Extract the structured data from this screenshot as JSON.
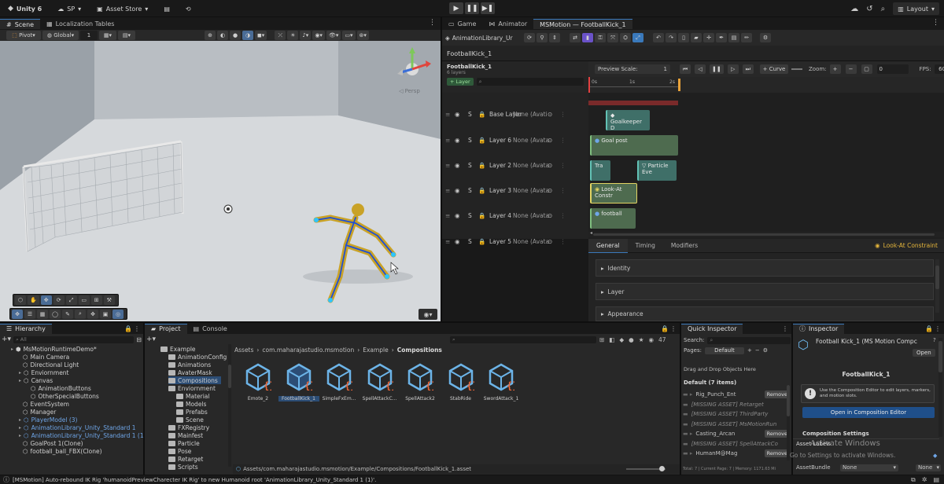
{
  "topbar": {
    "app": "Unity 6",
    "account": "SP",
    "asset_store": "Asset Store",
    "layout": "Layout"
  },
  "tabs_left": [
    "Scene",
    "Localization Tables"
  ],
  "tabs_right": [
    "Game",
    "Animator",
    "MSMotion — FootballKick_1"
  ],
  "scene_toolbar": {
    "pivot": "Pivot",
    "global": "Global",
    "grid_value": "1",
    "persp": "◁ Persp"
  },
  "msmotion": {
    "library": "AnimationLibrary_Ur",
    "title": "FootballKick_1",
    "comp_name": "FootballKick_1",
    "layer_count": "6 layers",
    "add_layer": "+ Layer",
    "preview_scale_label": "Preview Scale:",
    "preview_scale": "1",
    "curve": "+ Curve",
    "zoom": "Zoom:",
    "frame": "0",
    "fps_label": "FPS:",
    "fps": "60",
    "ruler": [
      "0s",
      "1s",
      "2s"
    ],
    "layers": [
      {
        "name": "Base Layer",
        "mask": "None (Avati"
      },
      {
        "name": "Layer 6",
        "mask": "None (Avata"
      },
      {
        "name": "Layer 2",
        "mask": "None (Avata"
      },
      {
        "name": "Layer 3",
        "mask": "None (Avata"
      },
      {
        "name": "Layer 4",
        "mask": "None (Avata"
      },
      {
        "name": "Layer 5",
        "mask": "None (Avata"
      }
    ],
    "clips": [
      "Goalkeeper D",
      "Goal post",
      "Tra",
      "Particle Eve",
      "Look-At Constr",
      "football"
    ],
    "inspector_tabs": [
      "General",
      "Timing",
      "Modifiers"
    ],
    "selected_marker": "Look-At Constraint",
    "sections": [
      "Identity",
      "Layer",
      "Appearance"
    ]
  },
  "hierarchy": {
    "title": "Hierarchy",
    "search": "All",
    "items": [
      {
        "label": "MsMotionRuntimeDemo*",
        "indent": 1,
        "blue": false
      },
      {
        "label": "Main Camera",
        "indent": 2,
        "blue": false
      },
      {
        "label": "Directional Light",
        "indent": 2,
        "blue": false
      },
      {
        "label": "Enviornment",
        "indent": 2,
        "blue": false
      },
      {
        "label": "Canvas",
        "indent": 2,
        "blue": false
      },
      {
        "label": "AnimationButtons",
        "indent": 3,
        "blue": false
      },
      {
        "label": "OtherSpecialButtons",
        "indent": 3,
        "blue": false
      },
      {
        "label": "EventSystem",
        "indent": 2,
        "blue": false
      },
      {
        "label": "Manager",
        "indent": 2,
        "blue": false
      },
      {
        "label": "PlayerModel (3)",
        "indent": 2,
        "blue": true
      },
      {
        "label": "AnimationLibrary_Unity_Standard 1",
        "indent": 2,
        "blue": true
      },
      {
        "label": "AnimationLibrary_Unity_Standard 1 (1)",
        "indent": 2,
        "blue": true
      },
      {
        "label": "GoalPost 1(Clone)",
        "indent": 2,
        "blue": false
      },
      {
        "label": "football_ball_FBX(Clone)",
        "indent": 2,
        "blue": false
      }
    ]
  },
  "project": {
    "tabs": [
      "Project",
      "Console"
    ],
    "count": "47",
    "folders": [
      {
        "label": "Example",
        "indent": 1
      },
      {
        "label": "AnimationConfig",
        "indent": 2
      },
      {
        "label": "Animations",
        "indent": 2
      },
      {
        "label": "AvaterMask",
        "indent": 2
      },
      {
        "label": "Compositions",
        "indent": 2
      },
      {
        "label": "Enviornment",
        "indent": 2
      },
      {
        "label": "Material",
        "indent": 3
      },
      {
        "label": "Models",
        "indent": 3
      },
      {
        "label": "Prefabs",
        "indent": 3
      },
      {
        "label": "Scene",
        "indent": 3
      },
      {
        "label": "FXRegistry",
        "indent": 2
      },
      {
        "label": "Mainfest",
        "indent": 2
      },
      {
        "label": "Particle",
        "indent": 2
      },
      {
        "label": "Pose",
        "indent": 2
      },
      {
        "label": "Retarget",
        "indent": 2
      },
      {
        "label": "Scripts",
        "indent": 2
      }
    ],
    "breadcrumb": [
      "Assets",
      "com.maharajastudio.msmotion",
      "Example",
      "Compositions"
    ],
    "assets": [
      "Emote_2",
      "FootballKick_1",
      "SimpleFxEm...",
      "SpellAttackC...",
      "SpellAttack2",
      "StabRide",
      "SwordAttack_1"
    ],
    "path": "Assets/com.maharajastudio.msmotion/Example/Compositions/FootballKick_1.asset"
  },
  "quick_inspector": {
    "title": "Quick Inspector",
    "search_label": "Search:",
    "pages_label": "Pages:",
    "pages_value": "Default",
    "drop_hint": "Drag and Drop Objects Here",
    "group": "Default (7 items)",
    "items": [
      {
        "label": "Rig_Punch_Ent",
        "remove": true
      },
      {
        "label": "[MISSING ASSET] Retarget",
        "remove": false
      },
      {
        "label": "[MISSING ASSET] ThirdParty",
        "remove": false
      },
      {
        "label": "[MISSING ASSET] MsMotionRun",
        "remove": false
      },
      {
        "label": "Casting_Arcan",
        "remove": true
      },
      {
        "label": "[MISSING ASSET] SpellAttackCo",
        "remove": false
      },
      {
        "label": "HumanM@Mag",
        "remove": true
      }
    ],
    "remove_label": "Remove",
    "footer": "Total: 7 | Current Page: 7 | Memory: 1171.63 Mi"
  },
  "inspector": {
    "title": "Inspector",
    "object": "Football Kick_1 (MS Motion Compc",
    "open": "Open",
    "name": "FootballKick_1",
    "info": "Use the Composition Editor to edit layers, markers, and motion slots.",
    "open_editor": "Open in Composition Editor",
    "settings": "Composition Settings",
    "labels_head": "Asset Labels",
    "bundle_label": "AssetBundle",
    "bundle_value": "None",
    "variant_value": "None",
    "watermark1": "Activate Windows",
    "watermark2": "Go to Settings to activate Windows."
  },
  "status": "[MSMotion] Auto-rebound IK Rig 'humanoidPreviewCharecter IK Rig' to new Humanoid root 'AnimationLibrary_Unity_Standard 1 (1)'."
}
